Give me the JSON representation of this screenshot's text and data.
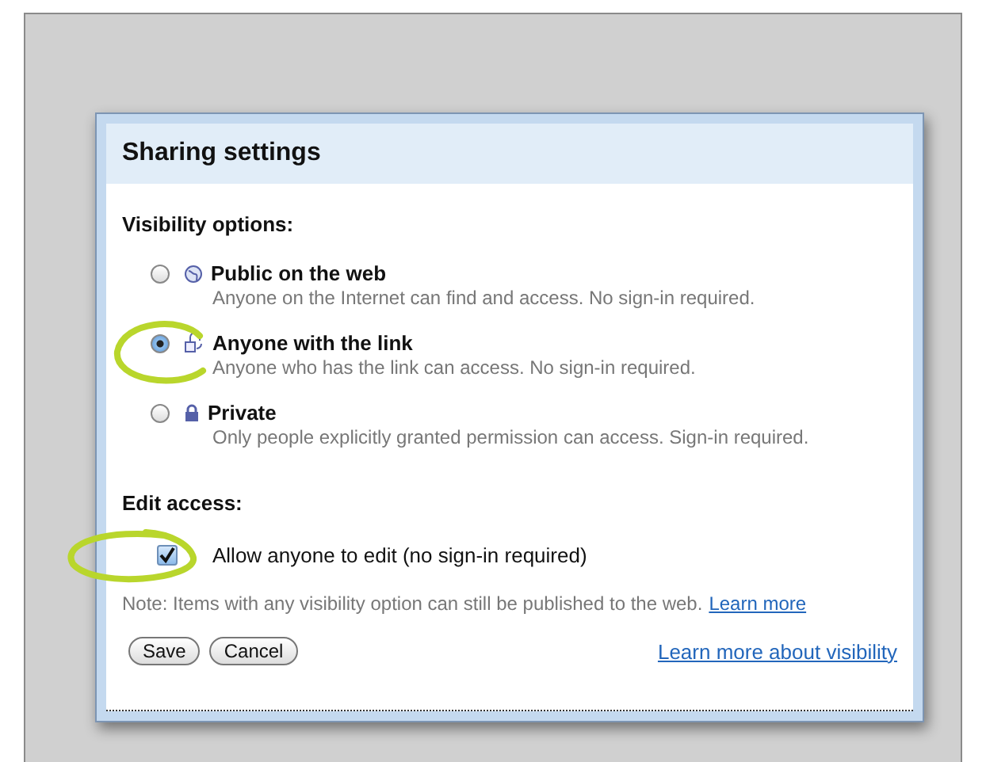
{
  "dialog": {
    "title": "Sharing settings"
  },
  "visibility": {
    "heading": "Visibility options:",
    "options": [
      {
        "kind": "globe",
        "label": "Public on the web",
        "description": "Anyone on the Internet can find and access. No sign-in required.",
        "selected": false
      },
      {
        "kind": "link",
        "label": "Anyone with the link",
        "description": "Anyone who has the link can access. No sign-in required.",
        "selected": true
      },
      {
        "kind": "lock",
        "label": "Private",
        "description": "Only people explicitly granted permission can access. Sign-in required.",
        "selected": false
      }
    ]
  },
  "edit_access": {
    "heading": "Edit access:",
    "label": "Allow anyone to edit (no sign-in required)",
    "checked": true
  },
  "note": {
    "text": "Note: Items with any visibility option can still be published to the web.",
    "link": "Learn more"
  },
  "buttons": [
    "Save",
    "Cancel"
  ],
  "footer_link": "Learn more about visibility"
}
